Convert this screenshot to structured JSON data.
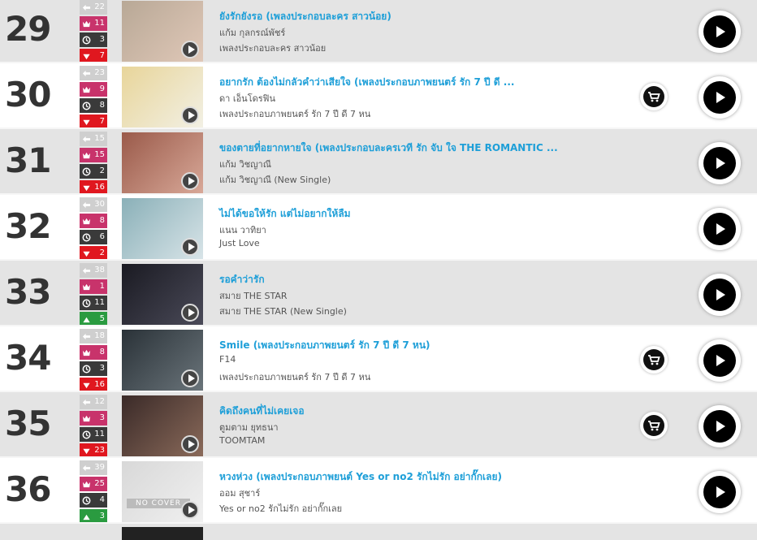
{
  "rows": [
    {
      "rank": "29",
      "prev": "22",
      "peak": "11",
      "weeks": "3",
      "move": "down",
      "change": "7",
      "title": "ยังรักยังรอ (เพลงประกอบละคร สาวน้อย)",
      "artist": "แก้ม กุลกรณ์พัชร์",
      "album": "เพลงประกอบละคร สาวน้อย",
      "cart": false,
      "thumb_colors": [
        "#b8a896",
        "#e0c8b8"
      ]
    },
    {
      "rank": "30",
      "prev": "23",
      "peak": "9",
      "weeks": "8",
      "move": "down",
      "change": "7",
      "title": "อยากรัก ต้องไม่กลัวคำว่าเสียใจ (เพลงประกอบภาพยนตร์ รัก 7 ปี ดี ...",
      "artist": "ดา เอ็นโดรฟิน",
      "album": "เพลงประกอบภาพยนตร์ รัก 7 ปี ดี 7 หน",
      "cart": true,
      "thumb_colors": [
        "#e8d59a",
        "#f2f0e4"
      ]
    },
    {
      "rank": "31",
      "prev": "15",
      "peak": "15",
      "weeks": "2",
      "move": "down",
      "change": "16",
      "title": "ของตายที่อยากหายใจ (เพลงประกอบละครเวที รัก จับ ใจ THE ROMANTIC ...",
      "artist": "แก้ม วิชญาณี",
      "album": "แก้ม วิชญาณี (New Single)",
      "cart": false,
      "thumb_colors": [
        "#9a5a4a",
        "#d8a898"
      ]
    },
    {
      "rank": "32",
      "prev": "30",
      "peak": "8",
      "weeks": "6",
      "move": "down",
      "change": "2",
      "title": "ไม่ได้ขอให้รัก แต่ไม่อยากให้ลืม",
      "artist": "แนน วาทิยา",
      "album": "Just Love",
      "cart": false,
      "thumb_colors": [
        "#8ab0b8",
        "#d8e4e8"
      ]
    },
    {
      "rank": "33",
      "prev": "38",
      "peak": "1",
      "weeks": "11",
      "move": "up",
      "change": "5",
      "title": "รอคำว่ารัก",
      "artist": "สมาย THE STAR",
      "album": "สมาย THE STAR (New Single)",
      "cart": false,
      "thumb_colors": [
        "#1a1a22",
        "#4a4a58"
      ]
    },
    {
      "rank": "34",
      "prev": "18",
      "peak": "8",
      "weeks": "3",
      "move": "down",
      "change": "16",
      "title": "Smile (เพลงประกอบภาพยนตร์ รัก 7 ปี ดี 7 หน)",
      "artist": "F14",
      "album": "เพลงประกอบภาพยนตร์ รัก 7 ปี ดี 7 หน",
      "cart": true,
      "thumb_colors": [
        "#2a3238",
        "#6a747a"
      ]
    },
    {
      "rank": "35",
      "prev": "12",
      "peak": "3",
      "weeks": "11",
      "move": "down",
      "change": "23",
      "title": "คิดถึงคนที่ไม่เคยเจอ",
      "artist": "ตูมตาม ยุทธนา",
      "album": "TOOMTAM",
      "cart": true,
      "thumb_colors": [
        "#3a2a28",
        "#8a6a5a"
      ]
    },
    {
      "rank": "36",
      "prev": "39",
      "peak": "25",
      "weeks": "4",
      "move": "up",
      "change": "3",
      "title": "หวงห่วง (เพลงประกอบภาพยนต์ Yes or no2 รักไม่รัก อย่ากั๊กเลย)",
      "artist": "ออม สุชาร์",
      "album": "Yes or no2 รักไม่รัก อย่ากั๊กเลย",
      "cart": false,
      "no_cover": "NO COVER",
      "thumb_colors": [
        "#d8d8d8",
        "#f0f0f0"
      ]
    }
  ]
}
